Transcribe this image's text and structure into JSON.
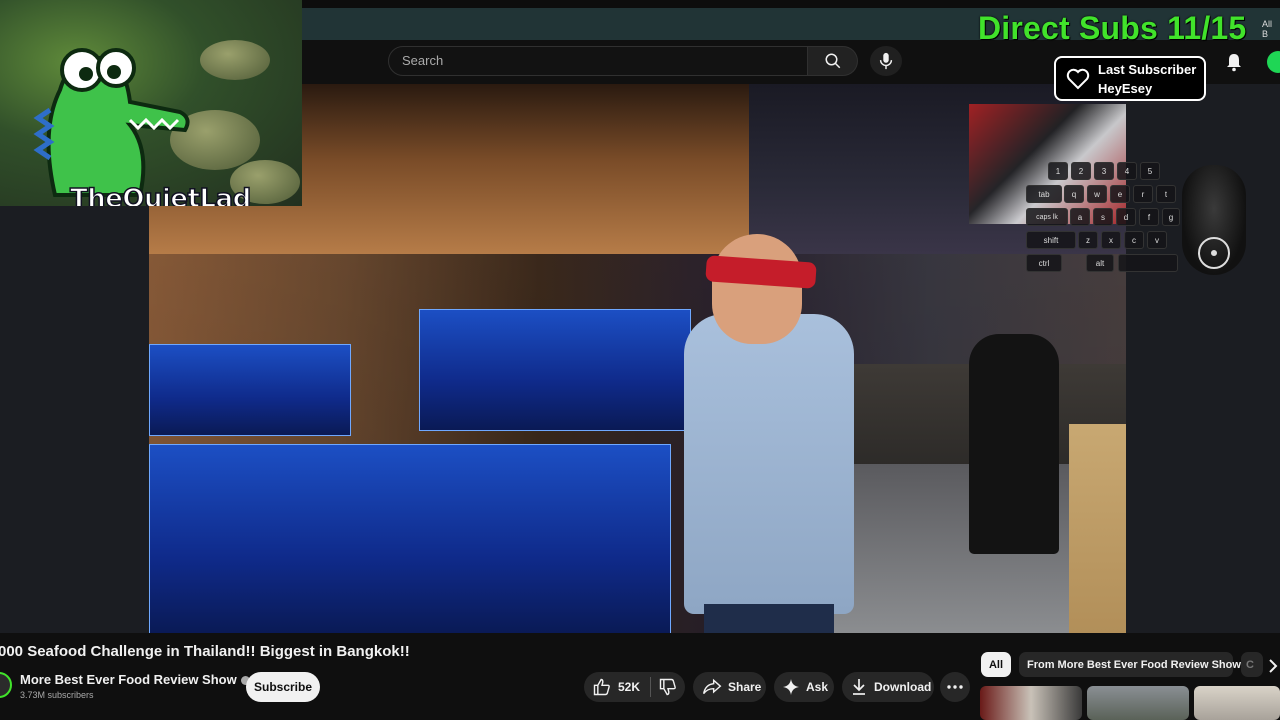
{
  "overlay": {
    "direct_subs": "Direct Subs 11/15",
    "last_subscriber_label": "Last Subscriber",
    "last_subscriber_name": "HeyEsey",
    "webcam_name": "TheQuietLad",
    "top_right_text": "All B"
  },
  "header": {
    "search_placeholder": "Search"
  },
  "keyboard": {
    "row1": [
      "1",
      "2",
      "3",
      "4",
      "5"
    ],
    "row2": [
      "tab",
      "q",
      "w",
      "e",
      "r",
      "t"
    ],
    "row3": [
      "caps lk",
      "a",
      "s",
      "d",
      "f",
      "g"
    ],
    "row4": [
      "shift",
      "z",
      "x",
      "c",
      "v"
    ],
    "row5": [
      "ctrl",
      "alt"
    ]
  },
  "video": {
    "title": "000 Seafood Challenge in Thailand!! Biggest in Bangkok!!",
    "channel": "More Best Ever Food Review Show",
    "subscribers": "3.73M subscribers",
    "subscribe_label": "Subscribe",
    "likes": "52K",
    "share_label": "Share",
    "ask_label": "Ask",
    "download_label": "Download"
  },
  "chips": {
    "all": "All",
    "from_channel": "From More Best Ever Food Review Show",
    "partial": "C"
  },
  "colors": {
    "accent_green": "#41e32b",
    "yt_bg": "#0f0f0f",
    "pill_bg": "#272727"
  }
}
